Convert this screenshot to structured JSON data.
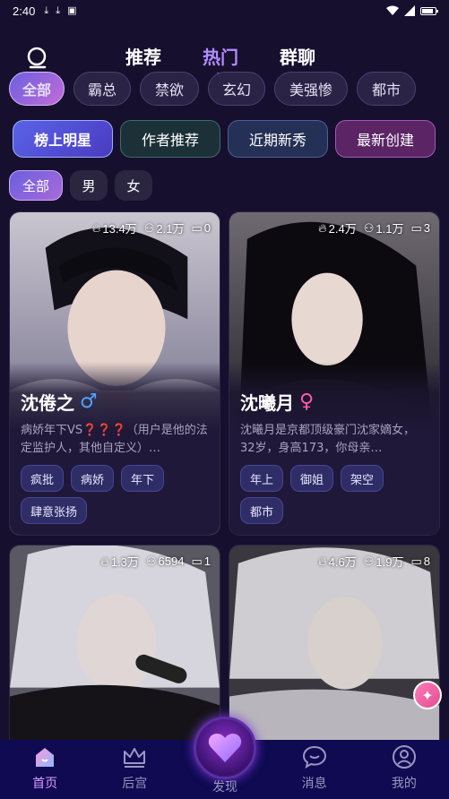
{
  "status_bar": {
    "time": "2:40"
  },
  "top_nav": {
    "tabs": [
      "推荐",
      "热门",
      "群聊"
    ],
    "active": "热门"
  },
  "genres": [
    "全部",
    "霸总",
    "禁欲",
    "玄幻",
    "美强惨",
    "都市"
  ],
  "rank_tabs": [
    "榜上明星",
    "作者推荐",
    "近期新秀",
    "最新创建"
  ],
  "gender_filters": [
    "全部",
    "男",
    "女"
  ],
  "cards": [
    {
      "views": "13.4万",
      "users": "2.1万",
      "comments": "0",
      "name": "沈倦之",
      "gender_symbol": "♂",
      "desc": "病娇年下VS❓❓❓（用户是他的法定监护人，其他自定义）…",
      "tags": [
        "疯批",
        "病娇",
        "年下",
        "肆意张扬"
      ]
    },
    {
      "views": "2.4万",
      "users": "1.1万",
      "comments": "3",
      "name": "沈曦月",
      "gender_symbol": "♀",
      "desc": "沈曦月是京都顶级豪门沈家嫡女，32岁，身高173，你母亲…",
      "tags": [
        "年上",
        "御姐",
        "架空",
        "都市"
      ]
    },
    {
      "views": "1.3万",
      "users": "6594",
      "comments": "1"
    },
    {
      "views": "4.6万",
      "users": "1.9万",
      "comments": "8"
    }
  ],
  "bottom_nav": {
    "home": "首页",
    "harem": "后宫",
    "discover": "发现",
    "messages": "消息",
    "mine": "我的"
  },
  "colors": {
    "accent": "#b18dff",
    "background": "#170f2e",
    "male": "#4da3ff",
    "female": "#ff5aa8"
  }
}
